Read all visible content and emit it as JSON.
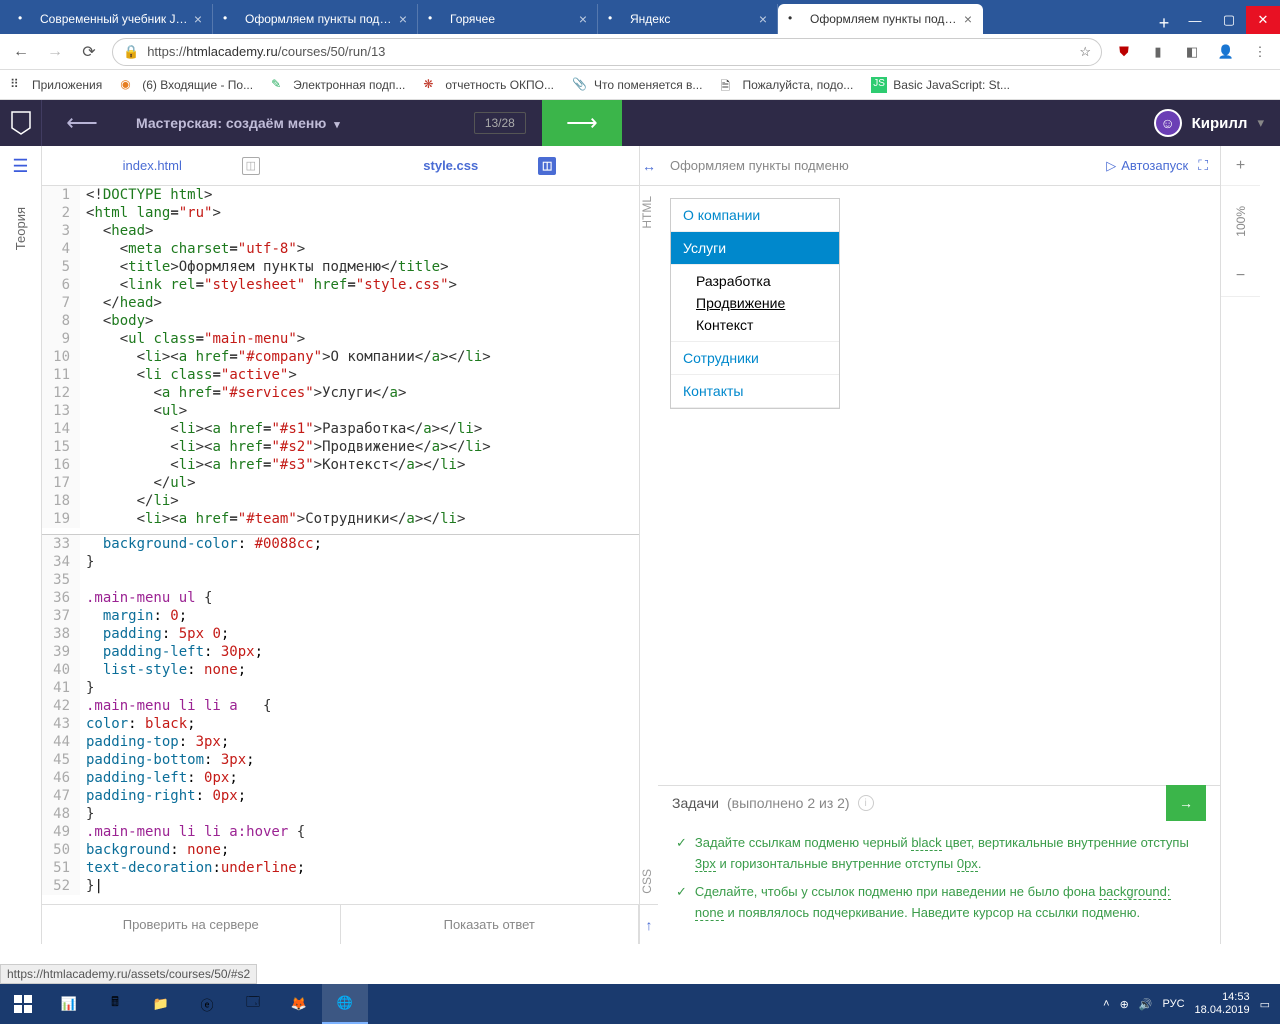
{
  "browser": {
    "tabs": [
      {
        "label": "Современный учебник Java..."
      },
      {
        "label": "Оформляем пункты подме..."
      },
      {
        "label": "Горячее"
      },
      {
        "label": "Яндекс"
      },
      {
        "label": "Оформляем пункты подме..."
      }
    ],
    "url_prefix": "https://",
    "url_host": "htmlacademy.ru",
    "url_path": "/courses/50/run/13",
    "bookmarks": [
      {
        "label": "Приложения"
      },
      {
        "label": "(6) Входящие - По..."
      },
      {
        "label": "Электронная подп..."
      },
      {
        "label": "отчетность ОКПО..."
      },
      {
        "label": "Что поменяется в..."
      },
      {
        "label": "Пожалуйста, подо..."
      },
      {
        "label": "Basic JavaScript: St..."
      }
    ],
    "status": "https://htmlacademy.ru/assets/courses/50/#s2"
  },
  "app": {
    "course_title": "Мастерская: создаём меню",
    "progress": "13/28",
    "username": "Кирилл",
    "leftrail_label": "Теория",
    "file_tabs": {
      "html": "index.html",
      "css": "style.css"
    },
    "bottom_actions": {
      "check": "Проверить на сервере",
      "show": "Показать ответ"
    }
  },
  "code_html": {
    "lines": [
      {
        "n": 1,
        "h": "<span class='t-punc'>&lt;!</span><span class='t-tag'>DOCTYPE html</span><span class='t-punc'>&gt;</span>"
      },
      {
        "n": 2,
        "h": "<span class='t-punc'>&lt;</span><span class='t-tag'>html</span> <span class='t-attr'>lang</span>=<span class='t-str'>\"ru\"</span><span class='t-punc'>&gt;</span>"
      },
      {
        "n": 3,
        "h": "  <span class='t-punc'>&lt;</span><span class='t-tag'>head</span><span class='t-punc'>&gt;</span>"
      },
      {
        "n": 4,
        "h": "    <span class='t-punc'>&lt;</span><span class='t-tag'>meta</span> <span class='t-attr'>charset</span>=<span class='t-str'>\"utf-8\"</span><span class='t-punc'>&gt;</span>"
      },
      {
        "n": 5,
        "h": "    <span class='t-punc'>&lt;</span><span class='t-tag'>title</span><span class='t-punc'>&gt;</span><span class='t-txt'>Оформляем пункты подменю</span><span class='t-punc'>&lt;/</span><span class='t-tag'>title</span><span class='t-punc'>&gt;</span>"
      },
      {
        "n": 6,
        "h": "    <span class='t-punc'>&lt;</span><span class='t-tag'>link</span> <span class='t-attr'>rel</span>=<span class='t-str'>\"stylesheet\"</span> <span class='t-attr'>href</span>=<span class='t-str'>\"style.css\"</span><span class='t-punc'>&gt;</span>"
      },
      {
        "n": 7,
        "h": "  <span class='t-punc'>&lt;/</span><span class='t-tag'>head</span><span class='t-punc'>&gt;</span>"
      },
      {
        "n": 8,
        "h": "  <span class='t-punc'>&lt;</span><span class='t-tag'>body</span><span class='t-punc'>&gt;</span>"
      },
      {
        "n": 9,
        "h": "    <span class='t-punc'>&lt;</span><span class='t-tag'>ul</span> <span class='t-attr'>class</span>=<span class='t-str'>\"main-menu\"</span><span class='t-punc'>&gt;</span>"
      },
      {
        "n": 10,
        "h": "      <span class='t-punc'>&lt;</span><span class='t-tag'>li</span><span class='t-punc'>&gt;&lt;</span><span class='t-tag'>a</span> <span class='t-attr'>href</span>=<span class='t-str'>\"#company\"</span><span class='t-punc'>&gt;</span><span class='t-txt'>О компании</span><span class='t-punc'>&lt;/</span><span class='t-tag'>a</span><span class='t-punc'>&gt;&lt;/</span><span class='t-tag'>li</span><span class='t-punc'>&gt;</span>"
      },
      {
        "n": 11,
        "h": "      <span class='t-punc'>&lt;</span><span class='t-tag'>li</span> <span class='t-attr'>class</span>=<span class='t-str'>\"active\"</span><span class='t-punc'>&gt;</span>"
      },
      {
        "n": 12,
        "h": "        <span class='t-punc'>&lt;</span><span class='t-tag'>a</span> <span class='t-attr'>href</span>=<span class='t-str'>\"#services\"</span><span class='t-punc'>&gt;</span><span class='t-txt'>Услуги</span><span class='t-punc'>&lt;/</span><span class='t-tag'>a</span><span class='t-punc'>&gt;</span>"
      },
      {
        "n": 13,
        "h": "        <span class='t-punc'>&lt;</span><span class='t-tag'>ul</span><span class='t-punc'>&gt;</span>"
      },
      {
        "n": 14,
        "h": "          <span class='t-punc'>&lt;</span><span class='t-tag'>li</span><span class='t-punc'>&gt;&lt;</span><span class='t-tag'>a</span> <span class='t-attr'>href</span>=<span class='t-str'>\"#s1\"</span><span class='t-punc'>&gt;</span><span class='t-txt'>Разработка</span><span class='t-punc'>&lt;/</span><span class='t-tag'>a</span><span class='t-punc'>&gt;&lt;/</span><span class='t-tag'>li</span><span class='t-punc'>&gt;</span>"
      },
      {
        "n": 15,
        "h": "          <span class='t-punc'>&lt;</span><span class='t-tag'>li</span><span class='t-punc'>&gt;&lt;</span><span class='t-tag'>a</span> <span class='t-attr'>href</span>=<span class='t-str'>\"#s2\"</span><span class='t-punc'>&gt;</span><span class='t-txt'>Продвижение</span><span class='t-punc'>&lt;/</span><span class='t-tag'>a</span><span class='t-punc'>&gt;&lt;/</span><span class='t-tag'>li</span><span class='t-punc'>&gt;</span>"
      },
      {
        "n": 16,
        "h": "          <span class='t-punc'>&lt;</span><span class='t-tag'>li</span><span class='t-punc'>&gt;&lt;</span><span class='t-tag'>a</span> <span class='t-attr'>href</span>=<span class='t-str'>\"#s3\"</span><span class='t-punc'>&gt;</span><span class='t-txt'>Контекст</span><span class='t-punc'>&lt;/</span><span class='t-tag'>a</span><span class='t-punc'>&gt;&lt;/</span><span class='t-tag'>li</span><span class='t-punc'>&gt;</span>"
      },
      {
        "n": 17,
        "h": "        <span class='t-punc'>&lt;/</span><span class='t-tag'>ul</span><span class='t-punc'>&gt;</span>"
      },
      {
        "n": 18,
        "h": "      <span class='t-punc'>&lt;/</span><span class='t-tag'>li</span><span class='t-punc'>&gt;</span>"
      },
      {
        "n": 19,
        "h": "      <span class='t-punc'>&lt;</span><span class='t-tag'>li</span><span class='t-punc'>&gt;&lt;</span><span class='t-tag'>a</span> <span class='t-attr'>href</span>=<span class='t-str'>\"#team\"</span><span class='t-punc'>&gt;</span><span class='t-txt'>Сотрудники</span><span class='t-punc'>&lt;/</span><span class='t-tag'>a</span><span class='t-punc'>&gt;&lt;/</span><span class='t-tag'>li</span><span class='t-punc'>&gt;</span>"
      }
    ]
  },
  "code_css": {
    "lines": [
      {
        "n": 33,
        "h": "  <span class='t-prop'>background-color</span>: <span class='t-val'>#0088cc</span>;"
      },
      {
        "n": 34,
        "h": "<span class='t-punc'>}</span>"
      },
      {
        "n": 35,
        "h": ""
      },
      {
        "n": 36,
        "h": "<span class='t-sel'>.main-menu ul</span> <span class='t-punc'>{</span>"
      },
      {
        "n": 37,
        "h": "  <span class='t-prop'>margin</span>: <span class='t-val'>0</span>;"
      },
      {
        "n": 38,
        "h": "  <span class='t-prop'>padding</span>: <span class='t-val'>5px 0</span>;"
      },
      {
        "n": 39,
        "h": "  <span class='t-prop'>padding-left</span>: <span class='t-val'>30px</span>;"
      },
      {
        "n": 40,
        "h": "  <span class='t-prop'>list-style</span>: <span class='t-val'>none</span>;"
      },
      {
        "n": 41,
        "h": "<span class='t-punc'>}</span>"
      },
      {
        "n": 42,
        "h": "<span class='t-sel'>.main-menu li li a</span>   <span class='t-punc'>{</span>"
      },
      {
        "n": 43,
        "h": "<span class='t-prop'>color</span>: <span class='t-val'>black</span>;"
      },
      {
        "n": 44,
        "h": "<span class='t-prop'>padding-top</span>: <span class='t-val'>3px</span>;"
      },
      {
        "n": 45,
        "h": "<span class='t-prop'>padding-bottom</span>: <span class='t-val'>3px</span>;"
      },
      {
        "n": 46,
        "h": "<span class='t-prop'>padding-left</span>: <span class='t-val'>0px</span>;"
      },
      {
        "n": 47,
        "h": "<span class='t-prop'>padding-right</span>: <span class='t-val'>0px</span>;"
      },
      {
        "n": 48,
        "h": "<span class='t-punc'>}</span>"
      },
      {
        "n": 49,
        "h": "<span class='t-sel'>.main-menu li li a:hover</span> <span class='t-punc'>{</span>"
      },
      {
        "n": 50,
        "h": "<span class='t-prop'>background</span>: <span class='t-val'>none</span>;"
      },
      {
        "n": 51,
        "h": "<span class='t-prop'>text-decoration</span>:<span class='t-val'>underline</span>;"
      },
      {
        "n": 52,
        "h": "<span class='t-punc'>}</span>|"
      }
    ]
  },
  "preview": {
    "title": "Оформляем пункты подменю",
    "autorun": "Автозапуск",
    "html_label": "HTML",
    "css_label": "CSS",
    "zoom": "100%",
    "menu": {
      "items": [
        {
          "label": "О компании"
        },
        {
          "label": "Услуги",
          "active": true
        },
        {
          "label": "Сотрудники"
        },
        {
          "label": "Контакты"
        }
      ],
      "sub": [
        {
          "label": "Разработка"
        },
        {
          "label": "Продвижение",
          "hover": true
        },
        {
          "label": "Контекст"
        }
      ]
    }
  },
  "tasks": {
    "title": "Задачи",
    "done": "(выполнено 2 из 2)",
    "items": [
      "Задайте ссылкам подменю черный <span class='code-hl'>black</span> цвет, вертикальные внутренние отступы <span class='code-hl'>3px</span> и горизонтальные внутренние отступы <span class='code-hl'>0px</span>.",
      "Сделайте, чтобы у ссылок подменю при наведении не было фона <span class='code-hl'>background: none</span> и появлялось подчеркивание. Наведите курсор на ссылки подменю."
    ]
  },
  "system": {
    "lang": "РУС",
    "time": "14:53",
    "date": "18.04.2019"
  }
}
